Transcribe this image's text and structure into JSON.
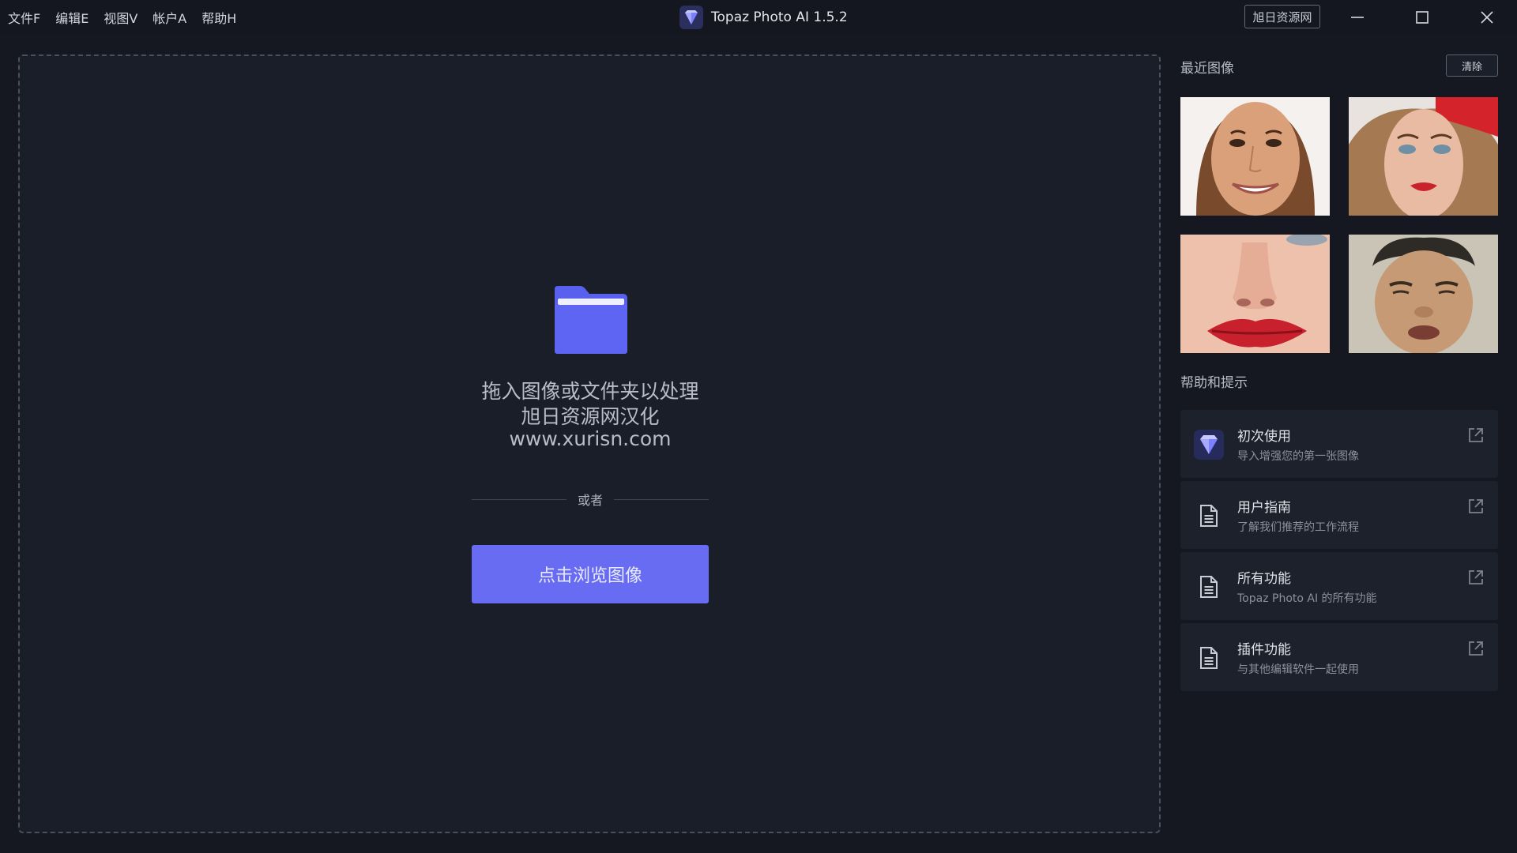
{
  "menu": {
    "items": [
      "文件F",
      "编辑E",
      "视图V",
      "帐户A",
      "帮助H"
    ]
  },
  "titlebar": {
    "app_name": "Topaz Photo AI 1.5.2",
    "badge": "旭日资源网"
  },
  "dropzone": {
    "line1": "拖入图像或文件夹以处理",
    "line2": "旭日资源网汉化",
    "line3": "www.xurisn.com",
    "or": "或者",
    "browse_label": "点击浏览图像"
  },
  "recent": {
    "title": "最近图像",
    "clear_label": "清除"
  },
  "help": {
    "title": "帮助和提示",
    "cards": [
      {
        "title": "初次使用",
        "subtitle": "导入增强您的第一张图像",
        "icon": "topaz-logo-icon"
      },
      {
        "title": "用户指南",
        "subtitle": "了解我们推荐的工作流程",
        "icon": "document-icon"
      },
      {
        "title": "所有功能",
        "subtitle": "Topaz Photo AI 的所有功能",
        "icon": "document-icon"
      },
      {
        "title": "插件功能",
        "subtitle": "与其他编辑软件一起使用",
        "icon": "document-icon"
      }
    ]
  },
  "colors": {
    "accent": "#676cf2",
    "folder": "#5a60ee",
    "background": "#151821"
  }
}
